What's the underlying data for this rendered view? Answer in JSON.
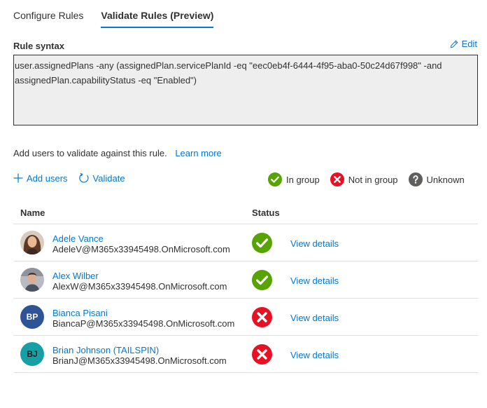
{
  "tabs": [
    {
      "label": "Configure Rules",
      "active": false
    },
    {
      "label": "Validate Rules (Preview)",
      "active": true
    }
  ],
  "rule_syntax": {
    "label": "Rule syntax",
    "edit_label": "Edit",
    "text": "user.assignedPlans -any (assignedPlan.servicePlanId -eq \"eec0eb4f-6444-4f95-aba0-50c24d67f998\" -and assignedPlan.capabilityStatus -eq \"Enabled\")"
  },
  "validation": {
    "hint": "Add users to validate against this rule.",
    "learn_more": "Learn more"
  },
  "toolbar": {
    "add_users": "Add users",
    "validate": "Validate"
  },
  "legend": {
    "in_group": "In group",
    "not_in_group": "Not in group",
    "unknown": "Unknown"
  },
  "colors": {
    "accent": "#0078d4",
    "in_group": "#57a300",
    "not_in_group": "#e81123",
    "unknown": "#605e5c"
  },
  "table": {
    "headers": {
      "name": "Name",
      "status": "Status"
    },
    "rows": [
      {
        "name": "Adele Vance",
        "email": "AdeleV@M365x33945498.OnMicrosoft.com",
        "avatar": "photo",
        "initials": "",
        "status": "in-group",
        "action": "View details"
      },
      {
        "name": "Alex Wilber",
        "email": "AlexW@M365x33945498.OnMicrosoft.com",
        "avatar": "photo",
        "initials": "",
        "status": "in-group",
        "action": "View details"
      },
      {
        "name": "Bianca Pisani",
        "email": "BiancaP@M365x33945498.OnMicrosoft.com",
        "avatar": "initials",
        "initials": "BP",
        "status": "not-in-group",
        "action": "View details"
      },
      {
        "name": "Brian Johnson (TAILSPIN)",
        "email": "BrianJ@M365x33945498.OnMicrosoft.com",
        "avatar": "initials",
        "initials": "BJ",
        "status": "not-in-group",
        "action": "View details"
      }
    ]
  }
}
